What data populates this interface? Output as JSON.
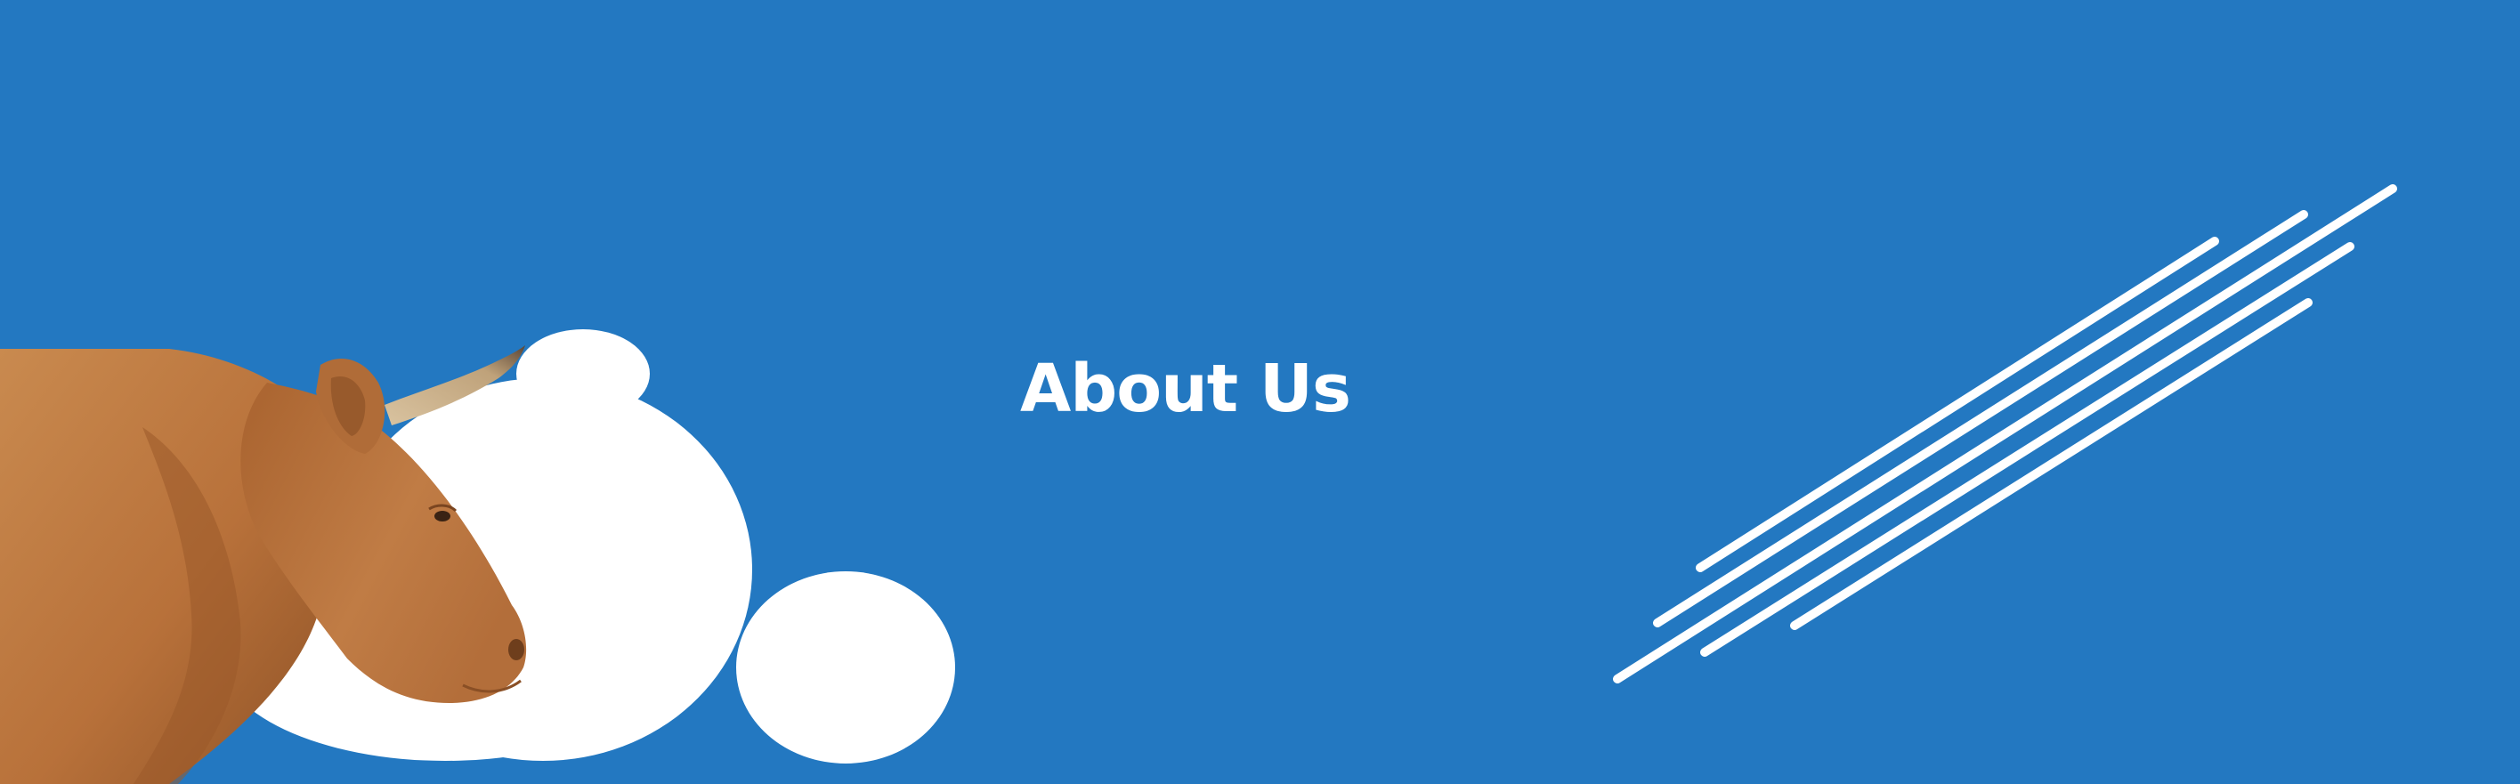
{
  "hero": {
    "title": "About Us",
    "background_color": "#2378C1",
    "accent_color": "#FFFFFF",
    "image_subject": "cow"
  }
}
